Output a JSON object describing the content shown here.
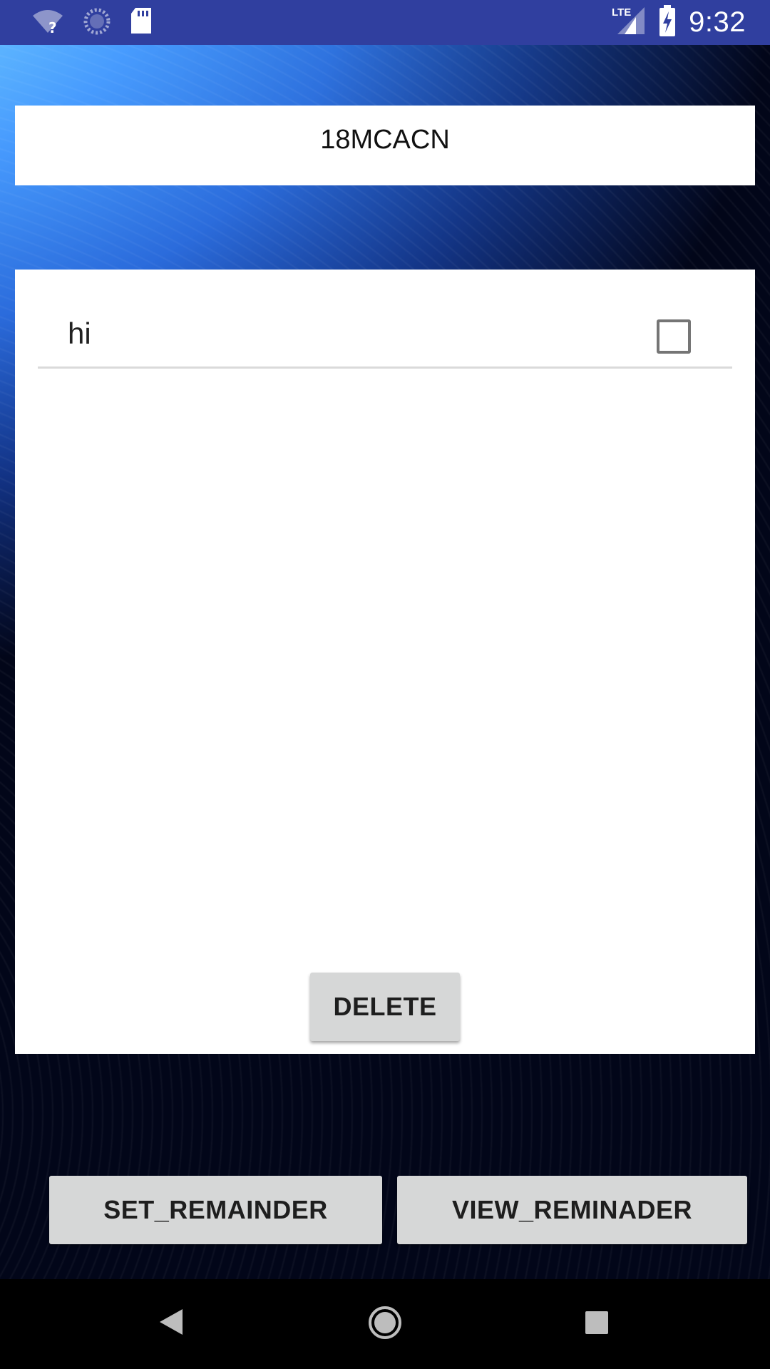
{
  "status_bar": {
    "time": "9:32",
    "network": "LTE",
    "icons": [
      "wifi-question-icon",
      "sync-icon",
      "sd-card-icon",
      "lte-signal-icon",
      "battery-charging-icon"
    ]
  },
  "header": {
    "title": "18MCACN"
  },
  "list": {
    "items": [
      {
        "label": "hi",
        "checked": false
      }
    ]
  },
  "actions": {
    "delete_label": "DELETE",
    "set_label": "SET_REMAINDER",
    "view_label": "VIEW_REMINADER"
  },
  "nav_bar": {
    "icons": [
      "back-icon",
      "home-icon",
      "recents-icon"
    ]
  },
  "colors": {
    "status_bar": "#303f9f",
    "button_bg": "#d6d7d7",
    "panel_bg": "#ffffff"
  }
}
